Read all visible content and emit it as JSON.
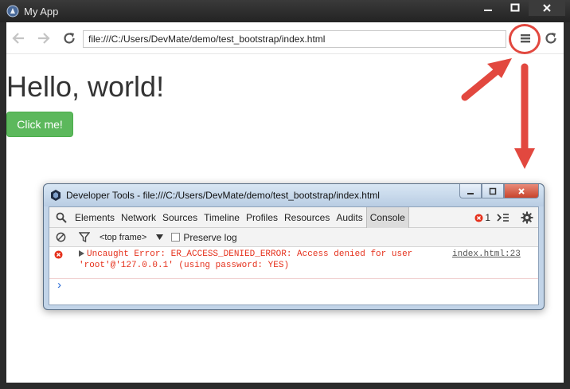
{
  "app": {
    "title": "My App",
    "window_buttons": {
      "minimize": "—",
      "maximize": "□",
      "close": "✕"
    }
  },
  "toolbar": {
    "back_icon": "arrow-left-icon",
    "forward_icon": "arrow-right-icon",
    "reload_icon": "reload-icon",
    "url": "file:///C:/Users/DevMate/demo/test_bootstrap/index.html",
    "menu_icon": "hamburger-menu-icon"
  },
  "page": {
    "heading": "Hello, world!",
    "button_label": "Click me!"
  },
  "annotations": {
    "ring_color": "#e2483f",
    "arrow_color": "#e2483f"
  },
  "devtools": {
    "title": "Developer Tools - file:///C:/Users/DevMate/demo/test_bootstrap/index.html",
    "tabs": [
      "Elements",
      "Network",
      "Sources",
      "Timeline",
      "Profiles",
      "Resources",
      "Audits",
      "Console"
    ],
    "active_tab": "Console",
    "error_count": "1",
    "filter": {
      "frame": "<top frame>",
      "preserve_log_label": "Preserve log"
    },
    "error": {
      "message_line1": "Uncaught Error: ER_ACCESS_DENIED_ERROR: Access denied for user",
      "message_line2": "'root'@'127.0.0.1' (using password: YES)",
      "source": "index.html:23"
    },
    "prompt": "›"
  },
  "colors": {
    "button_green": "#5cb85c",
    "error_red": "#e5301b"
  }
}
